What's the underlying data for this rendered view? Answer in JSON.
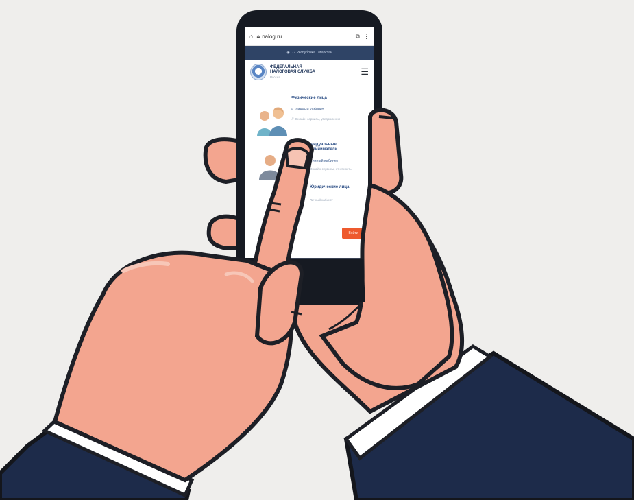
{
  "browser": {
    "url": "nalog.ru",
    "region": "77 Республика Татарстан"
  },
  "site": {
    "name_line1": "ФЕДЕРАЛЬНАЯ",
    "name_line2": "НАЛОГОВАЯ СЛУЖБА",
    "name_sub": "Россия",
    "menu_icon": "hamburger-menu-icon"
  },
  "sections": [
    {
      "title": "Физические лица",
      "line1": "Личный кабинет",
      "line2": "Онлайн-сервисы, уведомления"
    },
    {
      "title": "Индивидуальные предприниматели",
      "line1": "Личный кабинет",
      "line2": "Онлайн-сервисы, отчетность"
    },
    {
      "title": "Юридические лица",
      "line1": "Личный кабинет"
    }
  ],
  "login_button": "Войти",
  "colors": {
    "background": "#efeeec",
    "skin": "#f3a58f",
    "skin_shadow": "#e08a72",
    "outline": "#1d1f26",
    "suit": "#1d2b4a",
    "cuff": "#ffffff",
    "accent_button": "#ee5a2e",
    "header_bar": "#2f4466"
  }
}
